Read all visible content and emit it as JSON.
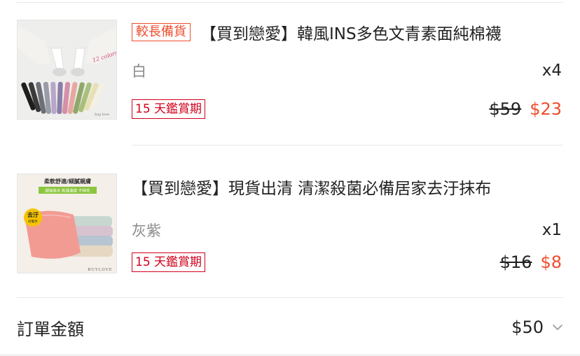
{
  "items": [
    {
      "tag": "較長備貨",
      "title": "【買到戀愛】韓風INS多色文青素面純棉襪",
      "variant": "白",
      "quantity": "x4",
      "trial_tag": "15 天鑑賞期",
      "original_price": "$59",
      "sale_price": "$23",
      "image_overlay_text": "12 colors"
    },
    {
      "tag": "",
      "title": "【買到戀愛】現貨出清 清潔殺菌必備居家去汙抹布",
      "variant": "灰紫",
      "quantity": "x1",
      "trial_tag": "15 天鑑賞期",
      "original_price": "$16",
      "sale_price": "$8",
      "image_overlay_text": {
        "headline": "柔軟舒適/細膩親膚",
        "subline": "超強吸水 乾燥速度 不掉毛",
        "badge": "去汙",
        "badge_sub": "好幫手",
        "brand": "BUYLOVE"
      }
    }
  ],
  "order_total": {
    "label": "訂單金額",
    "amount": "$50",
    "expand_icon": "chevron-down-icon"
  },
  "colors": {
    "accent": "#ee4d2d",
    "trial_border": "#d0011b",
    "muted_text": "#8a8a8a",
    "divider": "#e8e8e8"
  }
}
